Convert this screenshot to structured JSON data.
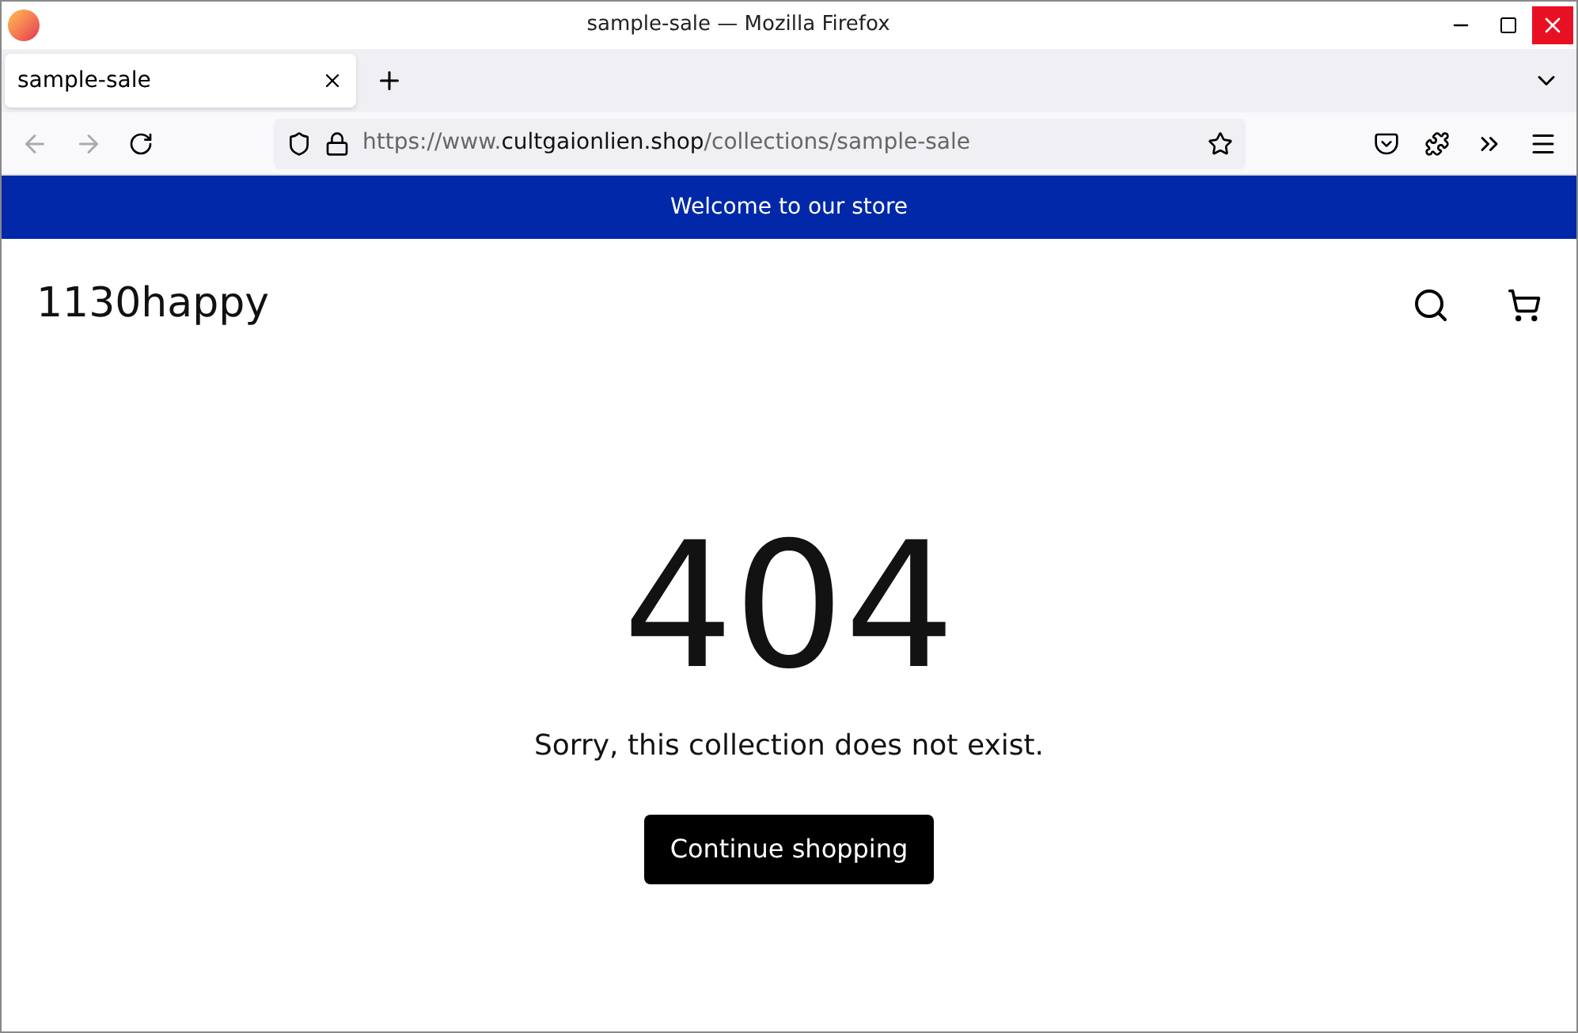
{
  "window": {
    "title": "sample-sale — Mozilla Firefox"
  },
  "tabs": [
    {
      "label": "sample-sale",
      "selected": true
    }
  ],
  "address_bar": {
    "url_prefix": "https://www.",
    "url_domain": "cultgaionlien.shop",
    "url_path": "/collections/sample-sale"
  },
  "announcement": "Welcome to our store",
  "header": {
    "logo": "1130happy"
  },
  "error": {
    "code": "404",
    "message": "Sorry, this collection does not exist.",
    "button": "Continue shopping"
  }
}
